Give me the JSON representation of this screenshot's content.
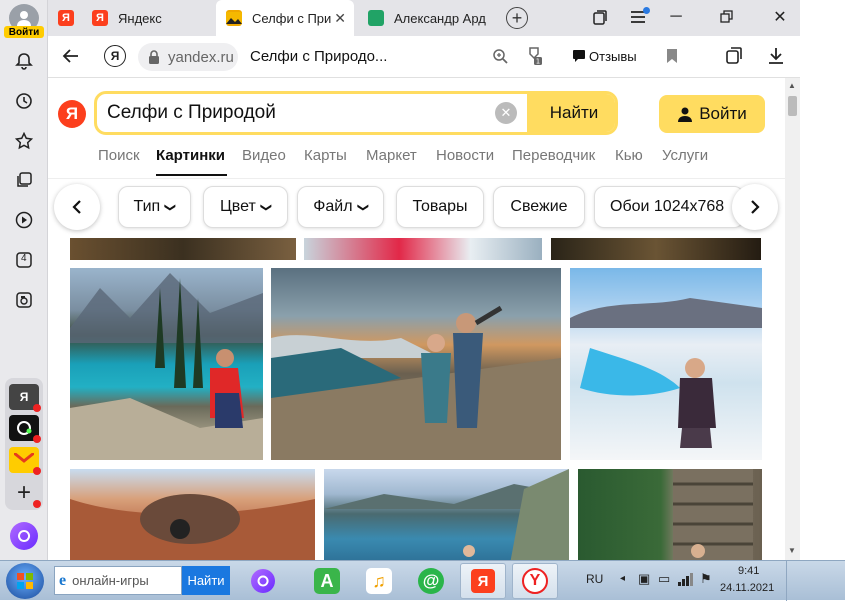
{
  "sidebar": {
    "login_label": "Войти",
    "badge_num": "4"
  },
  "tabs": [
    {
      "label": "Яндекс"
    },
    {
      "label": "Селфи с При"
    },
    {
      "label": "Александр Ард"
    }
  ],
  "address": {
    "domain": "yandex.ru",
    "title": "Селфи с Природо...",
    "reviews_label": "Отзывы"
  },
  "header": {
    "logo": "Я",
    "search_value": "Селфи с Природой",
    "search_button": "Найти",
    "login_button": "Войти"
  },
  "services": [
    {
      "label": "Поиск"
    },
    {
      "label": "Картинки"
    },
    {
      "label": "Видео"
    },
    {
      "label": "Карты"
    },
    {
      "label": "Маркет"
    },
    {
      "label": "Новости"
    },
    {
      "label": "Переводчик"
    },
    {
      "label": "Кью"
    },
    {
      "label": "Услуги"
    }
  ],
  "filters": [
    {
      "label": "Тип",
      "dropdown": true
    },
    {
      "label": "Цвет",
      "dropdown": true
    },
    {
      "label": "Файл",
      "dropdown": true
    },
    {
      "label": "Товары",
      "dropdown": false
    },
    {
      "label": "Свежие",
      "dropdown": false
    },
    {
      "label": "Обои 1024x768",
      "dropdown": false
    }
  ],
  "taskbar": {
    "search_value": "онлайн-игры",
    "search_button": "Найти",
    "lang": "RU",
    "time": "9:41",
    "date": "24.11.2021"
  },
  "colors": {
    "accent_yellow": "#ffdc60",
    "yandex_red": "#fc3f1d",
    "alice_purple": "#8a4dff"
  }
}
